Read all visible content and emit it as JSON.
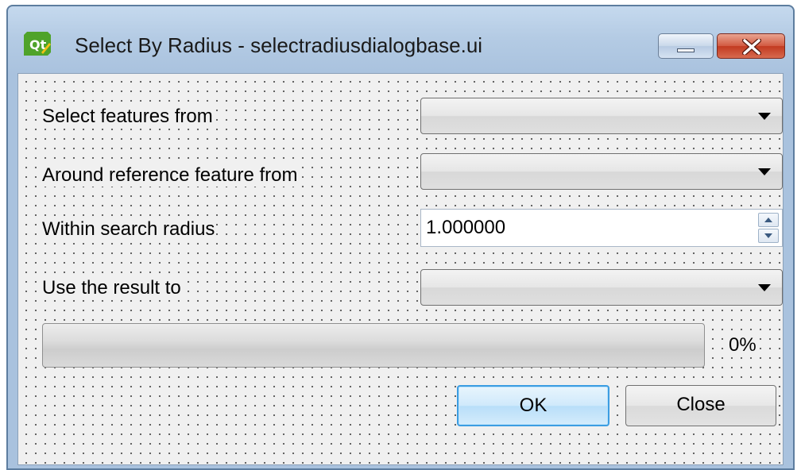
{
  "window": {
    "title": "Select By Radius - selectradiusdialogbase.ui",
    "icon": "qt-designer-icon"
  },
  "form": {
    "select_features_label": "Select features from",
    "select_features_value": "",
    "reference_label": "Around reference feature from",
    "reference_value": "",
    "radius_label": "Within search radius",
    "radius_value": "1.000000",
    "result_label": "Use the result to",
    "result_value": ""
  },
  "progress": {
    "value_percent": 0,
    "label": "0%"
  },
  "buttons": {
    "ok": "OK",
    "close": "Close"
  }
}
